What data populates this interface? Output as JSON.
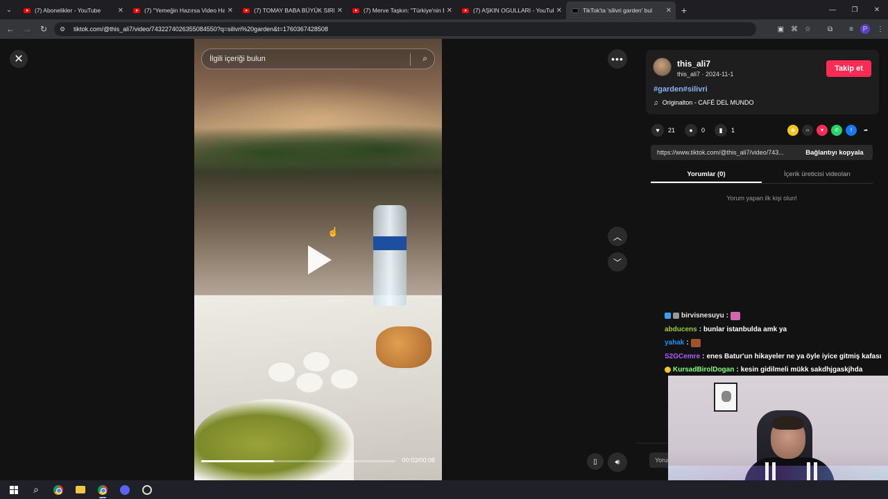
{
  "browser": {
    "tabs": [
      {
        "title": "(7) Abonelikler - YouTube",
        "icon": "youtube-icon",
        "active": false
      },
      {
        "title": "(7) \"Yemeğin Hazırsa Video Ha",
        "icon": "youtube-icon",
        "active": false
      },
      {
        "title": "(7) TOMAY BABA BÜYÜK SIRRI",
        "icon": "youtube-icon",
        "active": false
      },
      {
        "title": "(7) Merve Taşkın: \"Türkiye'nin E",
        "icon": "youtube-icon",
        "active": false
      },
      {
        "title": "(7) AŞKIN OGULLARI - YouTube",
        "icon": "youtube-icon",
        "active": false
      },
      {
        "title": "TikTok'ta 'silivri garden' bul",
        "icon": "tiktok-icon",
        "active": true
      }
    ],
    "url": "tiktok.com/@this_ali7/video/7432274026355084550?q=silivri%20garden&t=1760367428508",
    "profile_initial": "P"
  },
  "video": {
    "search_placeholder": "İlgili içeriği bulun",
    "time": "00:03/00:08",
    "progress_fraction": 0.375
  },
  "author": {
    "username": "this_ali7",
    "meta": "this_ali7 · 2024-11-1",
    "follow_label": "Takip et",
    "hashtags": "#garden#silivri",
    "music": "Originalton - CAFÉ DEL MUNDO"
  },
  "stats": {
    "likes": "21",
    "comments": "0",
    "saves": "1"
  },
  "share_link": {
    "url": "https://www.tiktok.com/@this_ali7/video/743...",
    "copy_label": "Bağlantıyı kopyala"
  },
  "panel_tabs": {
    "comments": "Yorumlar (0)",
    "creator_videos": "İçerik üreticisi videoları"
  },
  "empty_comments": "Yorum yapan ilk kişi olun!",
  "comment_input_placeholder": "Yorum",
  "stream_chat": [
    {
      "user": "birvisnesuyu",
      "text": "",
      "color": "#e8e8e8"
    },
    {
      "user": "abducens",
      "text": "bunlar istanbulda amk ya",
      "color": "#9acd32"
    },
    {
      "user": "yahak",
      "text": "",
      "color": "#1e90ff"
    },
    {
      "user": "S2GCemre",
      "text": "enes Batur'un hikayeler ne ya öyle iyice gitmiş kafası",
      "color": "#b05cff"
    },
    {
      "user": "KursadBirolDogan",
      "text": "kesin gidilmeli mükk sakdhjgaskjhda",
      "color": "#7fff7f"
    }
  ],
  "colors": {
    "follow": "#fe2c55",
    "hashtag": "#8ab4f8",
    "page_bg": "#121212"
  }
}
